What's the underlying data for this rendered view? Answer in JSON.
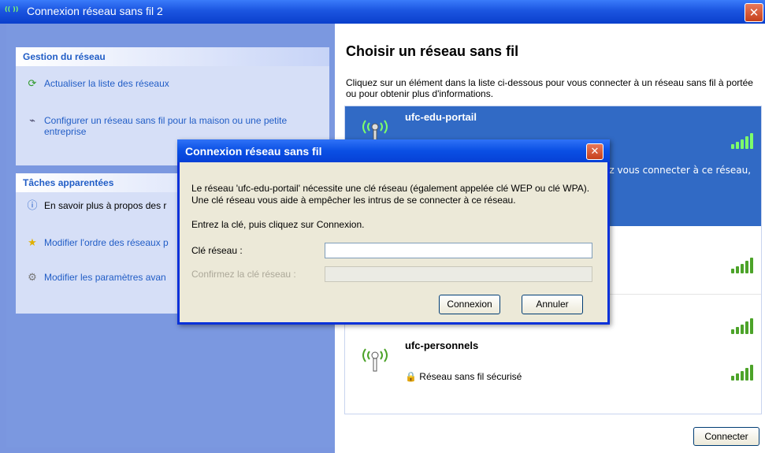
{
  "window": {
    "title": "Connexion réseau sans fil 2",
    "title_icon": "(( ))",
    "close_glyph": "✕"
  },
  "sidebar": {
    "network_panel": {
      "heading": "Gestion du réseau",
      "tasks": [
        {
          "label": "Actualiser la liste des réseaux",
          "icon": "refresh-icon"
        },
        {
          "label": "Configurer un réseau sans fil pour la maison ou une petite entreprise",
          "icon": "wizard-icon"
        }
      ]
    },
    "related_panel": {
      "heading": "Tâches apparentées",
      "tasks": [
        {
          "label": "En savoir plus à propos des r",
          "icon": "info-icon"
        },
        {
          "label": "Modifier l'ordre des réseaux p",
          "icon": "star-icon"
        },
        {
          "label": "Modifier les paramètres avan",
          "icon": "settings-icon"
        }
      ]
    }
  },
  "main": {
    "title": "Choisir un réseau sans fil",
    "description": "Cliquez sur un élément dans la liste ci-dessous pour vous connecter à un réseau sans fil à portée ou pour obtenir plus d'informations.",
    "selected_overflow_text": "ez vous connecter à ce réseau,",
    "networks": [
      {
        "name": "ufc-edu-portail",
        "selected": true,
        "status": ""
      },
      {
        "name": "",
        "selected": false,
        "status": ""
      },
      {
        "name": "",
        "selected": false,
        "status": ""
      },
      {
        "name": "ufc-personnels",
        "selected": false,
        "status": "Réseau sans fil sécurisé"
      }
    ],
    "connect_button": "Connecter"
  },
  "dialog": {
    "title": "Connexion réseau sans fil",
    "close_glyph": "✕",
    "message": "Le réseau 'ufc-edu-portail' nécessite une clé réseau (également appelée clé WEP ou clé WPA). Une clé réseau vous aide à empêcher les intrus de se connecter à ce réseau.",
    "instruction": "Entrez la clé, puis cliquez sur Connexion.",
    "key_label": "Clé réseau :",
    "key_value": "",
    "confirm_label": "Confirmez la clé réseau :",
    "confirm_value": "",
    "ok_button": "Connexion",
    "cancel_button": "Annuler"
  },
  "colors": {
    "title_blue": "#0a3fcc",
    "selection_blue": "#316ac5",
    "link_blue": "#215dc6",
    "signal_green": "#4ca329",
    "close_red": "#c6401b"
  }
}
